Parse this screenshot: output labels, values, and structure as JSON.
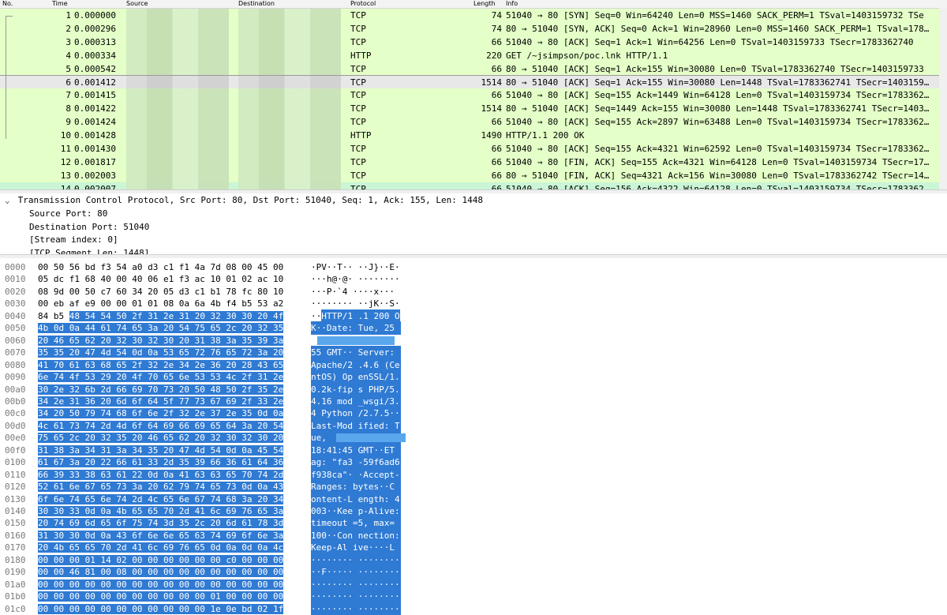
{
  "packet_list": {
    "columns": [
      "No.",
      "Time",
      "Source",
      "Destination",
      "Protocol",
      "Length",
      "Info"
    ],
    "rows": [
      {
        "no": "1",
        "time": "0.000000",
        "proto": "TCP",
        "len": "74",
        "info": "51040 → 80 [SYN] Seq=0 Win=64240 Len=0 MSS=1460 SACK_PERM=1 TSval=1403159732 TSe"
      },
      {
        "no": "2",
        "time": "0.000296",
        "proto": "TCP",
        "len": "74",
        "info": "80 → 51040 [SYN, ACK] Seq=0 Ack=1 Win=28960 Len=0 MSS=1460 SACK_PERM=1 TSval=178…"
      },
      {
        "no": "3",
        "time": "0.000313",
        "proto": "TCP",
        "len": "66",
        "info": "51040 → 80 [ACK] Seq=1 Ack=1 Win=64256 Len=0 TSval=1403159733 TSecr=1783362740"
      },
      {
        "no": "4",
        "time": "0.000334",
        "proto": "HTTP",
        "len": "220",
        "info": "GET /~jsimpson/poc.lnk HTTP/1.1"
      },
      {
        "no": "5",
        "time": "0.000542",
        "proto": "TCP",
        "len": "66",
        "info": "80 → 51040 [ACK] Seq=1 Ack=155 Win=30080 Len=0 TSval=1783362740 TSecr=1403159733"
      },
      {
        "no": "6",
        "time": "0.001412",
        "proto": "TCP",
        "len": "1514",
        "info": "80 → 51040 [ACK] Seq=1 Ack=155 Win=30080 Len=1448 TSval=1783362741 TSecr=1403159…"
      },
      {
        "no": "7",
        "time": "0.001415",
        "proto": "TCP",
        "len": "66",
        "info": "51040 → 80 [ACK] Seq=155 Ack=1449 Win=64128 Len=0 TSval=1403159734 TSecr=1783362…"
      },
      {
        "no": "8",
        "time": "0.001422",
        "proto": "TCP",
        "len": "1514",
        "info": "80 → 51040 [ACK] Seq=1449 Ack=155 Win=30080 Len=1448 TSval=1783362741 TSecr=1403…"
      },
      {
        "no": "9",
        "time": "0.001424",
        "proto": "TCP",
        "len": "66",
        "info": "51040 → 80 [ACK] Seq=155 Ack=2897 Win=63488 Len=0 TSval=1403159734 TSecr=1783362…"
      },
      {
        "no": "10",
        "time": "0.001428",
        "proto": "HTTP",
        "len": "1490",
        "info": "HTTP/1.1 200 OK"
      },
      {
        "no": "11",
        "time": "0.001430",
        "proto": "TCP",
        "len": "66",
        "info": "51040 → 80 [ACK] Seq=155 Ack=4321 Win=62592 Len=0 TSval=1403159734 TSecr=1783362…"
      },
      {
        "no": "12",
        "time": "0.001817",
        "proto": "TCP",
        "len": "66",
        "info": "51040 → 80 [FIN, ACK] Seq=155 Ack=4321 Win=64128 Len=0 TSval=1403159734 TSecr=17…"
      },
      {
        "no": "13",
        "time": "0.002003",
        "proto": "TCP",
        "len": "66",
        "info": "80 → 51040 [FIN, ACK] Seq=4321 Ack=156 Win=30080 Len=0 TSval=1783362742 TSecr=14…"
      },
      {
        "no": "14",
        "time": "0.002007",
        "proto": "TCP",
        "len": "66",
        "info": "51040 → 80 [ACK] Seq=156 Ack=4322 Win=64128 Len=0 TSval=1403159734 TSecr=1783362…"
      }
    ],
    "selected_no": "6"
  },
  "details": {
    "expander_icon": "chevron-down-icon",
    "lines": [
      "Transmission Control Protocol, Src Port: 80, Dst Port: 51040, Seq: 1, Ack: 155, Len: 1448",
      "Source Port: 80",
      "Destination Port: 51040",
      "[Stream index: 0]",
      "[TCP Segment Len: 1448]"
    ]
  },
  "bytes": {
    "rows": [
      {
        "off": "0000",
        "hex": "00 50 56 bd f3 54 a0 d3  c1 f1 4a 7d 08 00 45 00",
        "ascii": "·PV··T·· ··J}··E·"
      },
      {
        "off": "0010",
        "hex": "05 dc f1 68 40 00 40 06  e1 f3 ac 10 01 02 ac 10",
        "ascii": "···h@·@· ········"
      },
      {
        "off": "0020",
        "hex": "08 9d 00 50 c7 60 34 20  05 d3 c1 b1 78 fc 80 10",
        "ascii": "···P·`4  ····x···"
      },
      {
        "off": "0030",
        "hex": "00 eb af e9 00 00 01 01  08 0a 6a 4b f4 b5 53 a2",
        "ascii": "········ ··jK··S·"
      },
      {
        "off": "0040",
        "hex_pre": "84 b5 ",
        "hex": "48 54 54 50 2f 31  2e 31 20 32 30 30 20 4f",
        "ascii_pre": "··",
        "ascii": "HTTP/1 .1 200 O"
      },
      {
        "off": "0050",
        "hex": "4b 0d 0a 44 61 74 65 3a  20 54 75 65 2c 20 32 35",
        "ascii": "K··Date:  Tue, 25"
      },
      {
        "off": "0060",
        "hex": "20 46 65 62 20 32 30 32  30 20 31 38 3a 35 39 3a",
        "ascii": ""
      },
      {
        "off": "0070",
        "hex": "35 35 20 47 4d 54 0d 0a  53 65 72 76 65 72 3a 20",
        "ascii": "55 GMT·· Server: "
      },
      {
        "off": "0080",
        "hex": "41 70 61 63 68 65 2f 32  2e 34 2e 36 20 28 43 65",
        "ascii": "Apache/2 .4.6 (Ce"
      },
      {
        "off": "0090",
        "hex": "6e 74 4f 53 29 20 4f 70  65 6e 53 53 4c 2f 31 2e",
        "ascii": "ntOS) Op enSSL/1."
      },
      {
        "off": "00a0",
        "hex": "30 2e 32 6b 2d 66 69 70  73 20 50 48 50 2f 35 2e",
        "ascii": "0.2k-fip s PHP/5."
      },
      {
        "off": "00b0",
        "hex": "34 2e 31 36 20 6d 6f 64  5f 77 73 67 69 2f 33 2e",
        "ascii": "4.16 mod _wsgi/3."
      },
      {
        "off": "00c0",
        "hex": "34 20 50 79 74 68 6f 6e  2f 32 2e 37 2e 35 0d 0a",
        "ascii": "4 Python /2.7.5··"
      },
      {
        "off": "00d0",
        "hex": "4c 61 73 74 2d 4d 6f 64  69 66 69 65 64 3a 20 54",
        "ascii": "Last-Mod ified: T"
      },
      {
        "off": "00e0",
        "hex": "75 65 2c 20 32 35 20 46  65 62 20 32 30 32 30 20",
        "ascii": "ue,"
      },
      {
        "off": "00f0",
        "hex": "31 38 3a 34 31 3a 34 35  20 47 4d 54 0d 0a 45 54",
        "ascii": "18:41:45  GMT··ET"
      },
      {
        "off": "0100",
        "hex": "61 67 3a 20 22 66 61 33  2d 35 39 66 36 61 64 36",
        "ascii": "ag: \"fa3 -59f6ad6"
      },
      {
        "off": "0110",
        "hex": "66 39 33 38 63 61 22 0d  0a 41 63 63 65 70 74 2d",
        "ascii": "f938ca\"· ·Accept-"
      },
      {
        "off": "0120",
        "hex": "52 61 6e 67 65 73 3a 20  62 79 74 65 73 0d 0a 43",
        "ascii": "Ranges:  bytes··C"
      },
      {
        "off": "0130",
        "hex": "6f 6e 74 65 6e 74 2d 4c  65 6e 67 74 68 3a 20 34",
        "ascii": "ontent-L ength: 4"
      },
      {
        "off": "0140",
        "hex": "30 30 33 0d 0a 4b 65 65  70 2d 41 6c 69 76 65 3a",
        "ascii": "003··Kee p-Alive:"
      },
      {
        "off": "0150",
        "hex": "20 74 69 6d 65 6f 75 74  3d 35 2c 20 6d 61 78 3d",
        "ascii": " timeout =5, max="
      },
      {
        "off": "0160",
        "hex": "31 30 30 0d 0a 43 6f 6e  6e 65 63 74 69 6f 6e 3a",
        "ascii": "100··Con nection:"
      },
      {
        "off": "0170",
        "hex": "20 4b 65 65 70 2d 41 6c  69 76 65 0d 0a 0d 0a 4c",
        "ascii": " Keep-Al ive····L"
      },
      {
        "off": "0180",
        "hex": "00 00 00 01 14 02 00 00  00 00 00 00 c0 00 00 00",
        "ascii": "········ ········"
      },
      {
        "off": "0190",
        "hex": "00 00 46 81 00 08 00 00  00 00 00 00 00 00 00 00",
        "ascii": "··F····· ········"
      },
      {
        "off": "01a0",
        "hex": "00 00 00 00 00 00 00 00  00 00 00 00 00 00 00 00",
        "ascii": "········ ········"
      },
      {
        "off": "01b0",
        "hex": "00 00 00 00 00 00 00 00  00 00 00 01 00 00 00 00",
        "ascii": "········ ········"
      },
      {
        "off": "01c0",
        "hex": "00 00 00 00 00 00 00 00  00 00 00 1e 0e bd 02 1f",
        "ascii": "········ ········"
      }
    ]
  },
  "colors": {
    "tcp_row": "#e4ffc7",
    "selected_row": "#e8e8e8",
    "byte_highlight": "#2f7ad3"
  }
}
